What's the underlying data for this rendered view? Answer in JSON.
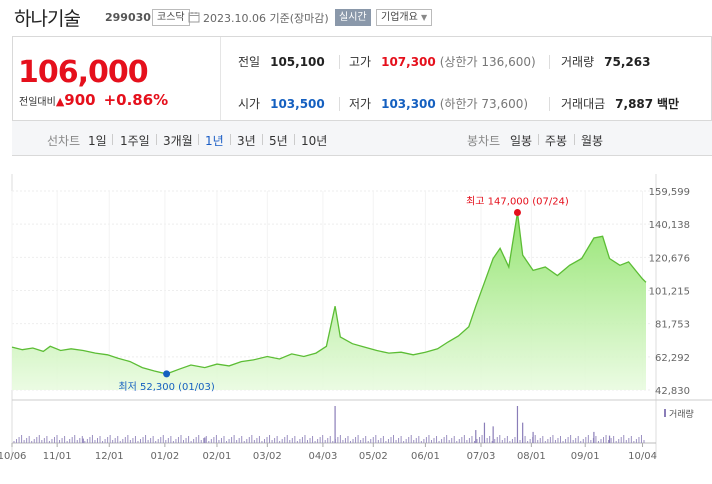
{
  "header": {
    "name": "하나기술",
    "code": "299030",
    "market": "코스닥",
    "date": "2023.10.06",
    "basis": "기준(장마감)",
    "realtime_label": "실시간",
    "info_label": "기업개요"
  },
  "price": {
    "now": "106,000",
    "diff_label": "전일대비",
    "diff_arrow": "▲",
    "diff": "900",
    "rate": "+0.86%"
  },
  "stats": {
    "prev_label": "전일",
    "prev": "105,100",
    "high_label": "고가",
    "high": "107,300",
    "upper": "(상한가 136,600)",
    "volume_label": "거래량",
    "volume": "75,263",
    "open_label": "시가",
    "open": "103,500",
    "low_label": "저가",
    "low": "103,300",
    "lower": "(하한가 73,600)",
    "amount_label": "거래대금",
    "amount": "7,887",
    "amount_unit": "백만"
  },
  "tabs": {
    "line_caption": "선차트",
    "periods": [
      "1일",
      "1주일",
      "3개월",
      "1년",
      "3년",
      "5년",
      "10년"
    ],
    "active_period": "1년",
    "candle_caption": "봉차트",
    "candles": [
      "일봉",
      "주봉",
      "월봉"
    ]
  },
  "chart_data": {
    "type": "area",
    "y_ticks": [
      "159,599",
      "140,138",
      "120,676",
      "101,215",
      "81,753",
      "62,292",
      "42,830"
    ],
    "ylim": [
      42830,
      159599
    ],
    "x_ticks": [
      "10/06",
      "11/01",
      "12/01",
      "01/02",
      "02/01",
      "03/02",
      "04/03",
      "05/02",
      "06/01",
      "07/03",
      "08/01",
      "09/01",
      "10/04"
    ],
    "x_range": [
      "2022-10-06",
      "2023-10-06"
    ],
    "high_annotation": "최고 147,000 (07/24)",
    "low_annotation": "최저 52,300 (01/03)",
    "high": {
      "date": "2023-07-24",
      "value": 147000
    },
    "low": {
      "date": "2023-01-03",
      "value": 52300
    },
    "volume_legend": "거래량",
    "series": [
      {
        "values": [
          [
            "2022-10-06",
            68000
          ],
          [
            "2022-10-12",
            66500
          ],
          [
            "2022-10-18",
            67500
          ],
          [
            "2022-10-24",
            65500
          ],
          [
            "2022-10-28",
            68500
          ],
          [
            "2022-11-03",
            66000
          ],
          [
            "2022-11-09",
            67000
          ],
          [
            "2022-11-16",
            66000
          ],
          [
            "2022-11-23",
            64500
          ],
          [
            "2022-11-30",
            63500
          ],
          [
            "2022-12-06",
            61500
          ],
          [
            "2022-12-13",
            59500
          ],
          [
            "2022-12-20",
            56000
          ],
          [
            "2022-12-27",
            54000
          ],
          [
            "2023-01-03",
            52300
          ],
          [
            "2023-01-10",
            55000
          ],
          [
            "2023-01-17",
            57500
          ],
          [
            "2023-01-25",
            56000
          ],
          [
            "2023-02-01",
            58000
          ],
          [
            "2023-02-08",
            57000
          ],
          [
            "2023-02-15",
            59500
          ],
          [
            "2023-02-22",
            60500
          ],
          [
            "2023-03-02",
            62500
          ],
          [
            "2023-03-09",
            61000
          ],
          [
            "2023-03-16",
            64000
          ],
          [
            "2023-03-23",
            62500
          ],
          [
            "2023-03-30",
            64500
          ],
          [
            "2023-04-05",
            68500
          ],
          [
            "2023-04-10",
            92000
          ],
          [
            "2023-04-13",
            74000
          ],
          [
            "2023-04-20",
            70000
          ],
          [
            "2023-04-27",
            68000
          ],
          [
            "2023-05-04",
            66000
          ],
          [
            "2023-05-11",
            64500
          ],
          [
            "2023-05-18",
            65000
          ],
          [
            "2023-05-25",
            63500
          ],
          [
            "2023-06-01",
            65000
          ],
          [
            "2023-06-08",
            67000
          ],
          [
            "2023-06-14",
            71000
          ],
          [
            "2023-06-20",
            74500
          ],
          [
            "2023-06-26",
            80000
          ],
          [
            "2023-06-30",
            92000
          ],
          [
            "2023-07-05",
            106000
          ],
          [
            "2023-07-10",
            120000
          ],
          [
            "2023-07-14",
            126000
          ],
          [
            "2023-07-19",
            115000
          ],
          [
            "2023-07-24",
            147000
          ],
          [
            "2023-07-27",
            122000
          ],
          [
            "2023-08-02",
            113000
          ],
          [
            "2023-08-09",
            115000
          ],
          [
            "2023-08-16",
            110000
          ],
          [
            "2023-08-23",
            116000
          ],
          [
            "2023-08-30",
            120000
          ],
          [
            "2023-09-06",
            132000
          ],
          [
            "2023-09-11",
            133000
          ],
          [
            "2023-09-15",
            120000
          ],
          [
            "2023-09-21",
            116000
          ],
          [
            "2023-09-26",
            118000
          ],
          [
            "2023-10-04",
            108000
          ],
          [
            "2023-10-06",
            106000
          ]
        ]
      }
    ],
    "volume_spikes": [
      [
        "2023-04-10",
        1.0
      ],
      [
        "2023-06-30",
        0.35
      ],
      [
        "2023-07-05",
        0.55
      ],
      [
        "2023-07-10",
        0.45
      ],
      [
        "2023-07-24",
        1.0
      ],
      [
        "2023-07-27",
        0.55
      ],
      [
        "2023-08-02",
        0.3
      ],
      [
        "2023-09-06",
        0.3
      ],
      [
        "2023-09-15",
        0.2
      ],
      [
        "2023-01-25",
        0.15
      ],
      [
        "2022-11-16",
        0.12
      ]
    ]
  }
}
